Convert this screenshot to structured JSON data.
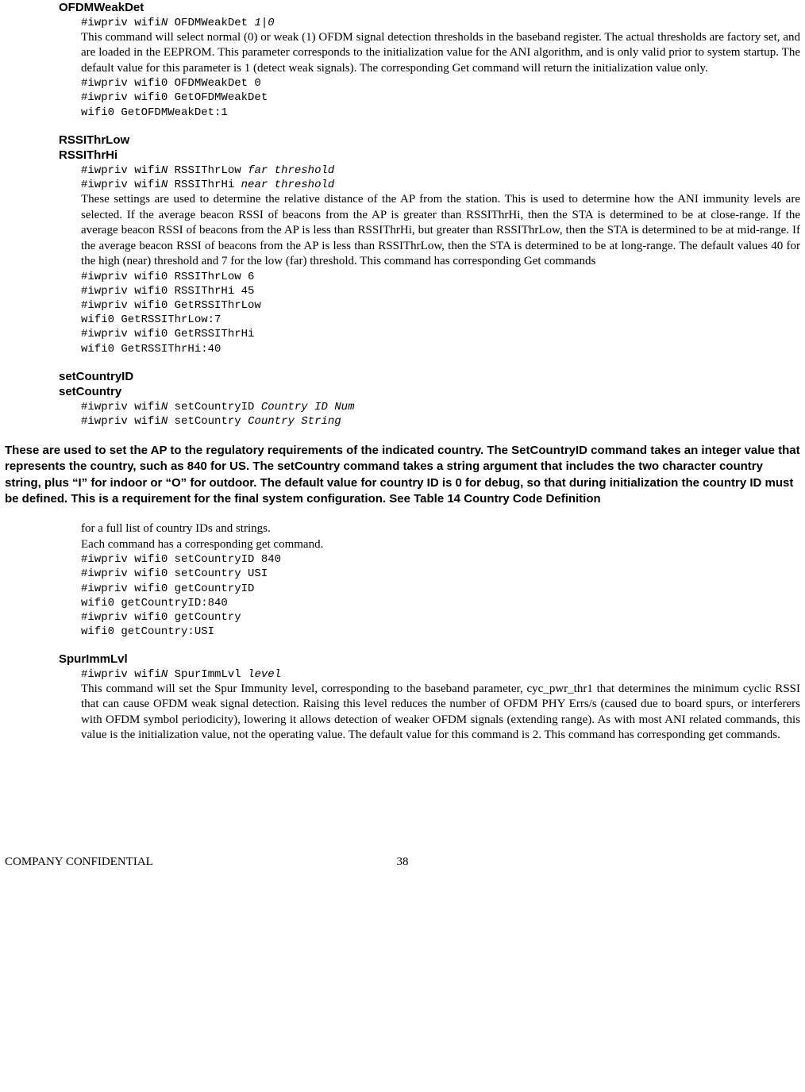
{
  "sections": {
    "ofdm": {
      "title": "OFDMWeakDet",
      "usage_pre": "#iwpriv wifi",
      "usage_ital": "N",
      "usage_post": " OFDMWeakDet ",
      "usage_arg_ital": "1|0",
      "desc": "This command will select normal (0) or weak (1) OFDM signal detection thresholds in the baseband register. The actual thresholds are factory set, and are loaded in the EEPROM. This parameter corresponds to the initialization value for the ANI algorithm, and is only valid prior to system startup. The default value for this parameter is 1 (detect weak signals). The corresponding Get command will return the initialization value only.",
      "example1": "#iwpriv wifi0 OFDMWeakDet 0",
      "example2": "#iwpriv wifi0 GetOFDMWeakDet",
      "example3": "wifi0 GetOFDMWeakDet:1"
    },
    "rssi": {
      "title1": "RSSIThrLow",
      "title2": "RSSIThrHi",
      "u1_pre": "#iwpriv wifi",
      "u1_mid": " RSSIThrLow ",
      "u1_arg": "far threshold",
      "u2_pre": "#iwpriv wifi",
      "u2_mid": " RSSIThrHi ",
      "u2_arg": "near threshold",
      "n_ital": "N",
      "desc": "These settings are used to determine the relative distance of the AP from the station. This is used to determine how the ANI immunity levels are selected. If the average beacon RSSI of beacons from the AP is greater than RSSIThrHi, then the STA is determined to be at close-range. If the average beacon RSSI of beacons from the AP is less than RSSIThrHi, but greater than RSSIThrLow, then the STA is determined to be at mid-range. If the average beacon RSSI of beacons from the AP is less than RSSIThrLow, then the STA is determined to be at long-range. The default values 40 for the high (near) threshold and 7 for the low (far) threshold. This command has corresponding Get commands",
      "e1": "#iwpriv wifi0 RSSIThrLow 6",
      "e2": "#iwpriv wifi0 RSSIThrHi 45",
      "e3": "#iwpriv wifi0 GetRSSIThrLow",
      "e4": "wifi0 GetRSSIThrLow:7",
      "e5": "#iwpriv wifi0 GetRSSIThrHi",
      "e6": "wifi0 GetRSSIThrHi:40"
    },
    "country": {
      "title1": "setCountryID",
      "title2": "setCountry",
      "u1_pre": "#iwpriv wifi",
      "u1_mid": " setCountryID ",
      "u1_arg": "Country ID Num",
      "u2_pre": "#iwpriv wifi",
      "u2_mid": " setCountry ",
      "u2_arg": "Country String",
      "n_ital": "N",
      "bold_para": "These are used to set the AP to the regulatory requirements of the indicated country. The SetCountryID command takes an integer value that represents the country, such as 840 for US. The setCountry command takes a string argument that includes the two character country string, plus “I” for indoor or “O” for outdoor. The default value for country ID is 0 for debug, so that during initialization the country ID must be defined. This is a requirement for the final system configuration. See Table 14 Country Code Definition",
      "prose1": "for a full list of country IDs and strings.",
      "prose2": "Each command has a corresponding get command.",
      "e1": "#iwpriv wifi0 setCountryID 840",
      "e2": "#iwpriv wifi0 setCountry USI",
      "e3": "#iwpriv wifi0 getCountryID",
      "e4": "wifi0 getCountryID:840",
      "e5": "#iwpriv wifi0 getCountry",
      "e6": "wifi0 getCountry:USI"
    },
    "spur": {
      "title": "SpurImmLvl",
      "usage_pre": "#iwpriv wifi",
      "usage_mid": " SpurImmLvl ",
      "usage_arg": "level",
      "n_ital": "N",
      "desc": "This command will set the Spur Immunity level, corresponding to the baseband parameter, cyc_pwr_thr1 that determines the minimum cyclic RSSI that can cause OFDM weak signal detection. Raising this level reduces the number of OFDM PHY Errs/s (caused due to board spurs, or interferers with OFDM symbol periodicity), lowering it allows detection of weaker OFDM signals (extending range). As with most ANI related commands, this value is the initialization value, not the operating value. The default value for this command is 2. This command has corresponding get commands."
    }
  },
  "footer": {
    "left": "COMPANY CONFIDENTIAL",
    "page": "38"
  }
}
